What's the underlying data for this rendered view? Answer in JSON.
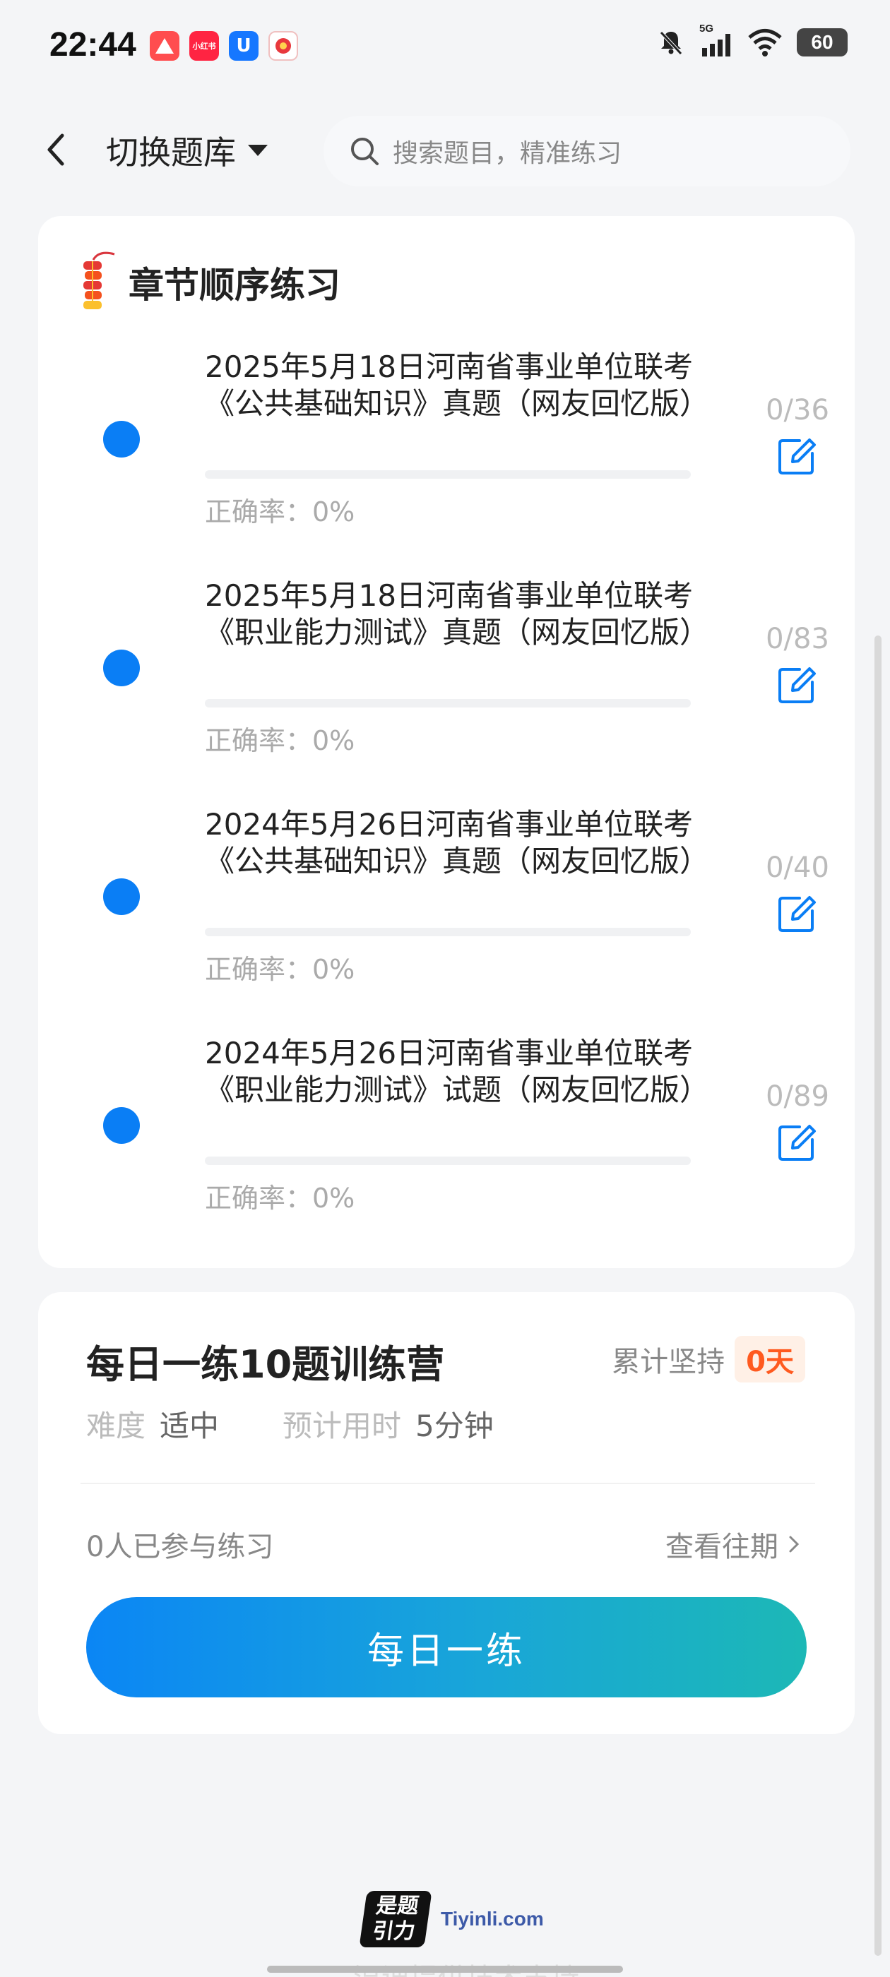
{
  "status_bar": {
    "time": "22:44",
    "app_icons": [
      {
        "name": "app-icon-1",
        "label": "",
        "color": "#ff4d4f"
      },
      {
        "name": "app-icon-xiaohongshu",
        "label": "小红书",
        "color": "#ff2442"
      },
      {
        "name": "app-icon-3",
        "label": "U",
        "color": "#1677ff"
      },
      {
        "name": "app-icon-4",
        "label": "",
        "color": "#f5a623"
      }
    ],
    "network": "5G",
    "battery": "60"
  },
  "header": {
    "bank_switch_label": "切换题库",
    "search_placeholder": "搜索题目，精准练习"
  },
  "chapter_section": {
    "title": "章节顺序练习",
    "items": [
      {
        "title": "2025年5月18日河南省事业单位联考《公共基础知识》真题（网友回忆版）",
        "accuracy": "正确率：0%",
        "count": "0/36",
        "progress": 0
      },
      {
        "title": "2025年5月18日河南省事业单位联考《职业能力测试》真题（网友回忆版）",
        "accuracy": "正确率：0%",
        "count": "0/83",
        "progress": 0
      },
      {
        "title": "2024年5月26日河南省事业单位联考《公共基础知识》真题（网友回忆版）",
        "accuracy": "正确率：0%",
        "count": "0/40",
        "progress": 0
      },
      {
        "title": "2024年5月26日河南省事业单位联考《职业能力测试》试题（网友回忆版）",
        "accuracy": "正确率：0%",
        "count": "0/89",
        "progress": 0
      }
    ]
  },
  "daily": {
    "title": "每日一练10题训练营",
    "persist_label": "累计坚持",
    "persist_value": "0天",
    "difficulty_label": "难度",
    "difficulty_value": "适中",
    "time_label": "预计用时",
    "time_value": "5分钟",
    "participants": "0人已参与练习",
    "history_link": "查看往期",
    "button_label": "每日一练"
  },
  "footer": {
    "logo_text_top": "是题",
    "logo_text_bottom": "引力",
    "domain": "Tiyinli.com",
    "faded_text": "温课提供技术支持"
  },
  "colors": {
    "accent": "#0a7ef5",
    "persist_badge": "#ff5a1f",
    "gradient_start": "#0b86f5",
    "gradient_end": "#1cb8b6"
  }
}
